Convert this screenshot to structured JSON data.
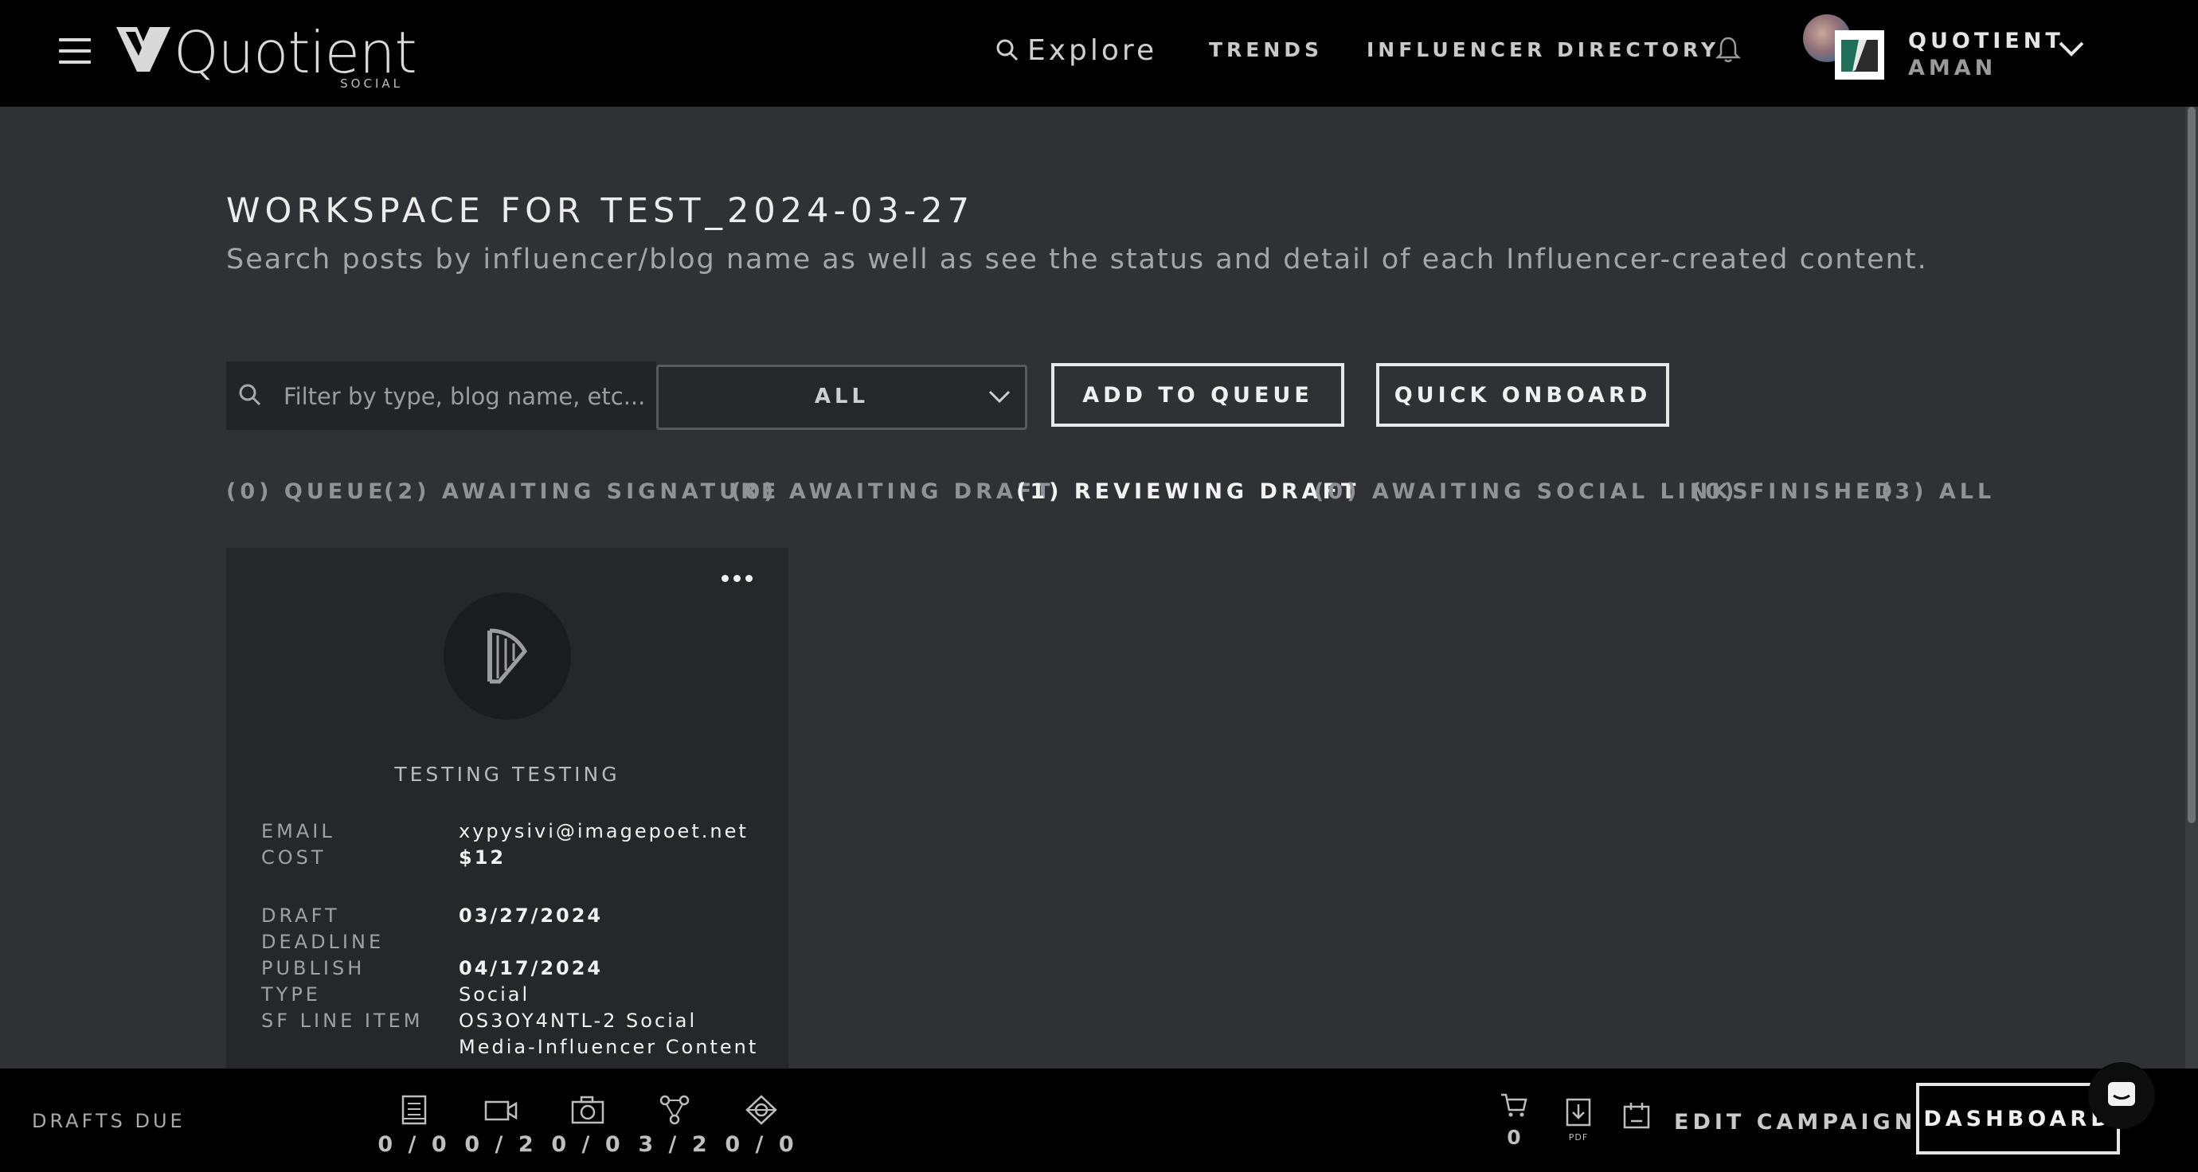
{
  "header": {
    "logo_text": "Quotient",
    "logo_sub": "SOCIAL",
    "explore_label": "Explore",
    "nav": [
      "TRENDS",
      "INFLUENCER DIRECTORY"
    ],
    "user": {
      "line1": "QUOTIENT",
      "line2": "AMAN"
    }
  },
  "page": {
    "title": "WORKSPACE FOR TEST_2024-03-27",
    "subtitle": "Search posts by influencer/blog name as well as see the status and detail of each Influencer-created content."
  },
  "toolbar": {
    "search_placeholder": "Filter by type, blog name, etc...",
    "select_value": "ALL",
    "add_queue_label": "ADD TO QUEUE",
    "quick_onboard_label": "QUICK ONBOARD"
  },
  "tabs": [
    {
      "label": "(0) QUEUE",
      "active": false
    },
    {
      "label": "(2) AWAITING SIGNATURE",
      "active": false
    },
    {
      "label": "(0) AWAITING DRAFT",
      "active": false
    },
    {
      "label": "(1) REVIEWING DRAFT",
      "active": true
    },
    {
      "label": "(0) AWAITING SOCIAL LINKS",
      "active": false
    },
    {
      "label": "(0) FINISHED",
      "active": false
    },
    {
      "label": "(3) ALL",
      "active": false
    }
  ],
  "card": {
    "name": "TESTING TESTING",
    "labels": {
      "email": "EMAIL",
      "cost": "COST",
      "draft_1": "DRAFT",
      "draft_2": "DEADLINE",
      "publish": "PUBLISH",
      "type": "TYPE",
      "sf": "SF LINE ITEM"
    },
    "values": {
      "email": "xypysivi@imagepoet.net",
      "cost": "$12",
      "draft_deadline": "03/27/2024",
      "publish": "04/17/2024",
      "type": "Social",
      "sf_line_1": "OS3OY4NTL-2 Social",
      "sf_line_2": "Media-Influencer Content"
    }
  },
  "bottom": {
    "drafts_due_label": "DRAFTS DUE",
    "stats": [
      {
        "icon": "blog-post-icon",
        "value": "0 / 0"
      },
      {
        "icon": "video-icon",
        "value": "0 / 2"
      },
      {
        "icon": "camera-icon",
        "value": "0 / 0"
      },
      {
        "icon": "social-share-icon",
        "value": "3 / 2"
      },
      {
        "icon": "channel-icon",
        "value": "0 / 0"
      }
    ],
    "cart_count": "0",
    "pdf_label": "PDF",
    "edit_campaign_label": "EDIT CAMPAIGN",
    "dashboard_label": "DASHBOARD"
  }
}
